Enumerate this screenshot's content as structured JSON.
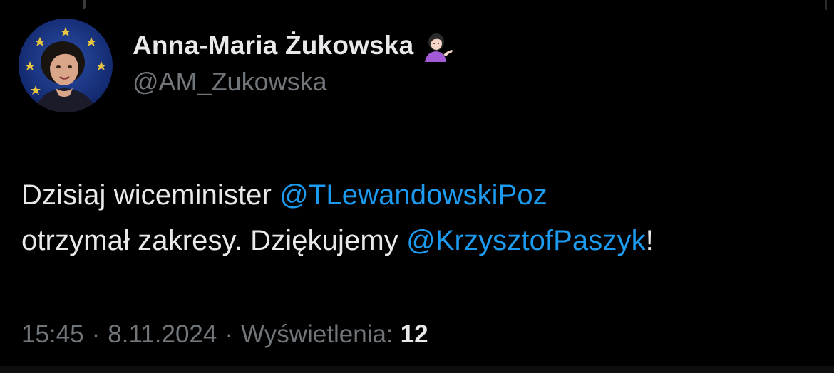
{
  "author": {
    "display_name": "Anna-Maria Żukowska",
    "handle": "@AM_Zukowska",
    "avatar_icon": "profile-photo-eu-flag-background",
    "name_emoji_icon": "woman-tipping-hand-emoji"
  },
  "tweet": {
    "text_part_1": "Dzisiaj wiceminister ",
    "mention_1": "@TLewandowskiPoz",
    "text_part_2": "otrzymał zakresy. Dziękujemy ",
    "mention_2": "@KrzysztofPaszyk",
    "text_part_3": "!"
  },
  "meta": {
    "time": "15:45",
    "separator": "·",
    "date": "8.11.2024",
    "views_label": "Wyświetlenia:",
    "views_count": "12"
  },
  "colors": {
    "background": "#000000",
    "text": "#e7e9ea",
    "muted": "#71767b",
    "link": "#1d9bf0"
  }
}
